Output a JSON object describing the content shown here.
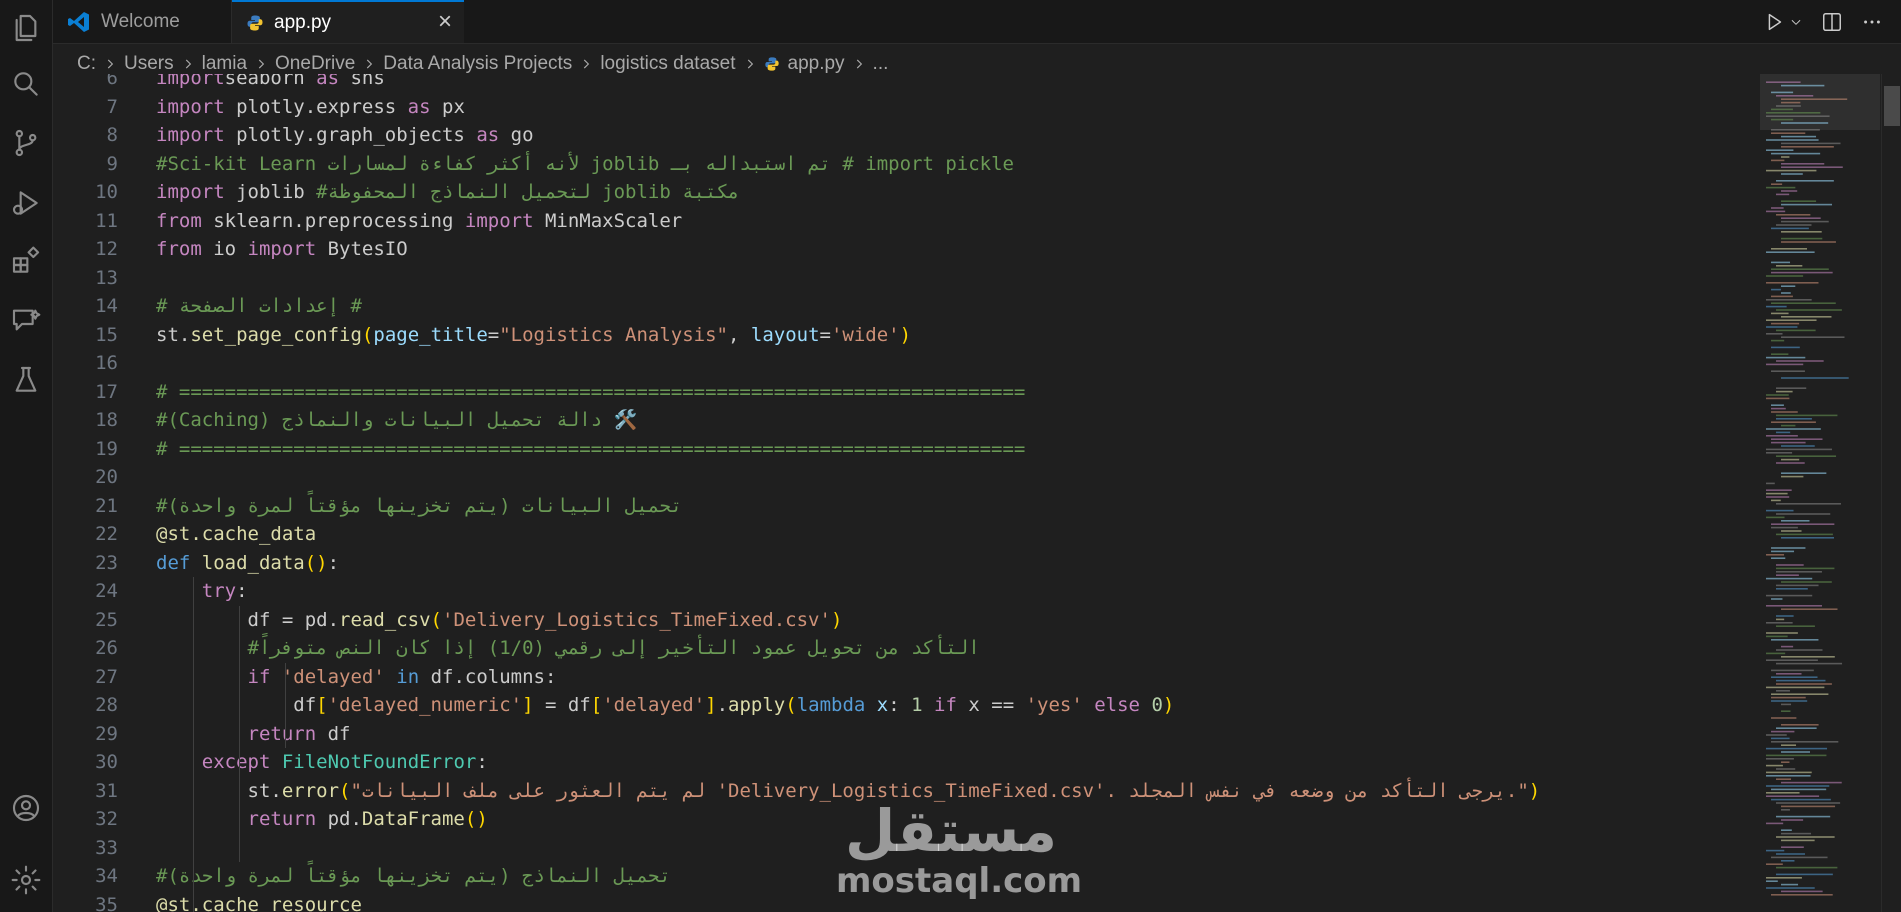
{
  "tabs": [
    {
      "label": "Welcome",
      "active": false
    },
    {
      "label": "app.py",
      "active": true
    }
  ],
  "breadcrumb": [
    "C:",
    "Users",
    "lamia",
    "OneDrive",
    "Data Analysis Projects",
    "logistics dataset",
    "app.py",
    "..."
  ],
  "editor": {
    "lines": [
      {
        "n": "6"
      },
      {
        "n": "7"
      },
      {
        "n": "8"
      },
      {
        "n": "9"
      },
      {
        "n": "10"
      },
      {
        "n": "11"
      },
      {
        "n": "12"
      },
      {
        "n": "13"
      },
      {
        "n": "14"
      },
      {
        "n": "15"
      },
      {
        "n": "16"
      },
      {
        "n": "17"
      },
      {
        "n": "18"
      },
      {
        "n": "19"
      },
      {
        "n": "20"
      },
      {
        "n": "21"
      },
      {
        "n": "22"
      },
      {
        "n": "23"
      },
      {
        "n": "24"
      },
      {
        "n": "25"
      },
      {
        "n": "26"
      },
      {
        "n": "27"
      },
      {
        "n": "28"
      },
      {
        "n": "29"
      },
      {
        "n": "30"
      },
      {
        "n": "31"
      },
      {
        "n": "32"
      },
      {
        "n": "33"
      },
      {
        "n": "34"
      },
      {
        "n": "35"
      }
    ],
    "code": [
      [
        [
          "kw-import",
          "import"
        ],
        [
          "",
          "seaborn "
        ],
        [
          "kw-import",
          "as"
        ],
        [
          "",
          " sns"
        ]
      ],
      [
        [
          "kw-import",
          "import"
        ],
        [
          "",
          " plotly.express "
        ],
        [
          "kw-import",
          "as"
        ],
        [
          "",
          " px"
        ]
      ],
      [
        [
          "kw-import",
          "import"
        ],
        [
          "",
          " plotly.graph_objects "
        ],
        [
          "kw-import",
          "as"
        ],
        [
          "",
          " go"
        ]
      ],
      [
        [
          "cmt",
          "#Sci-kit Learn لأنه أكثر كفاءة لمسارات joblib تم استبداله بـ # import pickle"
        ]
      ],
      [
        [
          "kw-import",
          "import"
        ],
        [
          "",
          " joblib "
        ],
        [
          "cmt",
          "#لتحميل النماذج المحفوظة joblib مكتبة"
        ]
      ],
      [
        [
          "kw-import",
          "from"
        ],
        [
          "",
          " sklearn.preprocessing "
        ],
        [
          "kw-import",
          "import"
        ],
        [
          "",
          " MinMaxScaler"
        ]
      ],
      [
        [
          "kw-import",
          "from"
        ],
        [
          "",
          " io "
        ],
        [
          "kw-import",
          "import"
        ],
        [
          "",
          " BytesIO"
        ]
      ],
      [],
      [
        [
          "cmt",
          "# إعدادات الصفحة #"
        ]
      ],
      [
        [
          "",
          "st."
        ],
        [
          "fn",
          "set_page_config"
        ],
        [
          "p1",
          "("
        ],
        [
          "param",
          "page_title"
        ],
        [
          "",
          "="
        ],
        [
          "str",
          "\"Logistics Analysis\""
        ],
        [
          "",
          ", "
        ],
        [
          "param",
          "layout"
        ],
        [
          "",
          "="
        ],
        [
          "str",
          "'wide'"
        ],
        [
          "p1",
          ")"
        ]
      ],
      [],
      [
        [
          "cmt",
          "# =========================================================================="
        ]
      ],
      [
        [
          "cmt",
          "#(Caching) دالة تحميل البيانات والنماذج 🛠️"
        ]
      ],
      [
        [
          "cmt",
          "# =========================================================================="
        ]
      ],
      [],
      [
        [
          "cmt",
          "#تحميل البيانات (يتم تخزينها مؤقتاً لمرة واحدة)"
        ]
      ],
      [
        [
          "fn",
          "@st.cache_data"
        ]
      ],
      [
        [
          "kw",
          "def"
        ],
        [
          "",
          " "
        ],
        [
          "fn",
          "load_data"
        ],
        [
          "p1",
          "()"
        ],
        [
          "",
          ":"
        ]
      ],
      [
        [
          "",
          "    "
        ],
        [
          "kwc",
          "try"
        ],
        [
          "",
          ":"
        ]
      ],
      [
        [
          "",
          "        df = pd."
        ],
        [
          "fn",
          "read_csv"
        ],
        [
          "p1",
          "("
        ],
        [
          "str",
          "'Delivery_Logistics_TimeFixed.csv'"
        ],
        [
          "p1",
          ")"
        ]
      ],
      [
        [
          "",
          "        "
        ],
        [
          "cmt",
          "#التأكد من تحويل عمود التأخير إلى رقمي (1/0) إذا كان النص متوفراً"
        ]
      ],
      [
        [
          "",
          "        "
        ],
        [
          "kwc",
          "if"
        ],
        [
          "",
          " "
        ],
        [
          "str",
          "'delayed'"
        ],
        [
          "",
          " "
        ],
        [
          "kw",
          "in"
        ],
        [
          "",
          " df.columns:"
        ]
      ],
      [
        [
          "",
          "            df"
        ],
        [
          "p1",
          "["
        ],
        [
          "str",
          "'delayed_numeric'"
        ],
        [
          "p1",
          "]"
        ],
        [
          "",
          " = df"
        ],
        [
          "p1",
          "["
        ],
        [
          "str",
          "'delayed'"
        ],
        [
          "p1",
          "]"
        ],
        [
          "",
          "."
        ],
        [
          "fn",
          "apply"
        ],
        [
          "p1",
          "("
        ],
        [
          "kw",
          "lambda"
        ],
        [
          "",
          " "
        ],
        [
          "param",
          "x"
        ],
        [
          "",
          ": "
        ],
        [
          "num",
          "1"
        ],
        [
          "",
          " "
        ],
        [
          "kwc",
          "if"
        ],
        [
          "",
          " x == "
        ],
        [
          "str",
          "'yes'"
        ],
        [
          "",
          " "
        ],
        [
          "kwc",
          "else"
        ],
        [
          "",
          " "
        ],
        [
          "num",
          "0"
        ],
        [
          "p1",
          ")"
        ]
      ],
      [
        [
          "",
          "        "
        ],
        [
          "kwc",
          "return"
        ],
        [
          "",
          " df"
        ]
      ],
      [
        [
          "",
          "    "
        ],
        [
          "kwc",
          "except"
        ],
        [
          "",
          " "
        ],
        [
          "cls",
          "FileNotFoundError"
        ],
        [
          "",
          ":"
        ]
      ],
      [
        [
          "",
          "        st."
        ],
        [
          "fn",
          "error"
        ],
        [
          "p1",
          "("
        ],
        [
          "str",
          "\"لم يتم العثور على ملف البيانات 'Delivery_Logistics_TimeFixed.csv'. يرجى التأكد من وضعه في نفس المجلد.\""
        ],
        [
          "p1",
          ")"
        ]
      ],
      [
        [
          "",
          "        "
        ],
        [
          "kwc",
          "return"
        ],
        [
          "",
          " pd."
        ],
        [
          "fn",
          "DataFrame"
        ],
        [
          "p1",
          "()"
        ]
      ],
      [],
      [
        [
          "cmt",
          "#تحميل النماذج (يتم تخزينها مؤقتاً لمرة واحدة)"
        ]
      ],
      [
        [
          "fn",
          "@st.cache_resource"
        ]
      ]
    ]
  },
  "watermark": {
    "arabic": "مستقل",
    "latin": "mostaql.com"
  },
  "icons": {
    "activity": [
      "files-icon",
      "search-icon",
      "source-control-icon",
      "run-debug-icon",
      "extensions-icon",
      "chat-icon",
      "testing-icon",
      "account-icon",
      "settings-gear-icon"
    ]
  },
  "colors": {
    "accent": "#0078d4",
    "editor_bg": "#1f1f1f",
    "comment": "#6a9955",
    "keyword": "#c586c0",
    "string": "#ce9178"
  }
}
